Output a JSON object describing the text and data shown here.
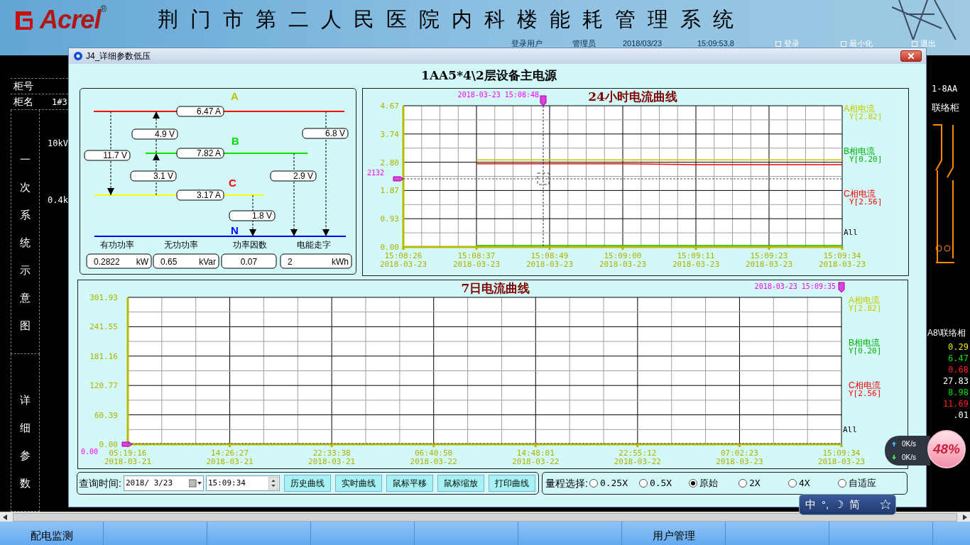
{
  "header": {
    "logo": "Acrel",
    "logo_mark": "®",
    "title": "荆门市第二人民医院内科楼能耗管理系统",
    "info": [
      "登录用户",
      "管理员",
      "2018/03/23",
      "15:09:53.8"
    ],
    "buttons": [
      "登录",
      "最小化",
      "退出"
    ]
  },
  "left_panel": {
    "rows": [
      {
        "label": "柜号"
      },
      {
        "label": "柜名",
        "value": "1#3"
      }
    ],
    "sections": [
      {
        "label": "一次系统示意图"
      },
      {
        "label": "详细参数"
      }
    ],
    "voltages": [
      "10kV",
      "0.4k"
    ]
  },
  "right_panel": {
    "cabinet": "1-8AA",
    "name": "联络柜",
    "title": "A8\\联络相",
    "values": [
      {
        "value": "0.29",
        "color": "#e8e800"
      },
      {
        "value": "6.47",
        "color": "#00e000"
      },
      {
        "value": "0.68",
        "color": "#ff2020"
      },
      {
        "value": "27.83",
        "color": "#ffffff"
      },
      {
        "value": "8.98",
        "color": "#00e000"
      },
      {
        "value": "11.69",
        "color": "#ff2020"
      },
      {
        "value": ".01",
        "color": "#ffffff"
      }
    ]
  },
  "dialog": {
    "title": "J4_详细参数低压",
    "heading": "1AA5*4\\2层设备主电源",
    "phasor": {
      "lines": [
        {
          "color": "#ff0000",
          "current": "6.47 A"
        },
        {
          "color": "#00e000",
          "current": "7.82 A"
        },
        {
          "color": "#ffff00",
          "current": "3.17 A"
        },
        {
          "color": "#0000ff"
        }
      ],
      "labels": [
        {
          "name": "A",
          "color": "#c0c000"
        },
        {
          "name": "B",
          "color": "#00e000"
        },
        {
          "name": "C",
          "color": "#ff0000"
        },
        {
          "name": "N",
          "color": "#0000ff"
        }
      ],
      "voltages": [
        "4.9 V",
        "6.8 V",
        "11.7 V",
        "3.1 V",
        "2.9 V",
        "1.8 V"
      ],
      "metrics": [
        {
          "label": "有功功率",
          "value": "0.2822",
          "unit": "kW"
        },
        {
          "label": "无功功率",
          "value": "0.65",
          "unit": "kVar"
        },
        {
          "label": "功率因数",
          "value": "0.07"
        },
        {
          "label": "电能走字",
          "value": "2",
          "unit": "kWh"
        }
      ]
    },
    "chart_24h": {
      "chart_data": {
        "type": "line",
        "title": "24小时电流曲线",
        "grid": true,
        "ylim": [
          0,
          4.67
        ],
        "categories": [
          "15:08:26",
          "15:08:37",
          "15:08:49",
          "15:09:00",
          "15:09:11",
          "15:09:23",
          "15:09:34"
        ],
        "yticks": [
          {
            "value": 0,
            "label": "0.00"
          },
          {
            "value": 0.93,
            "label": "0.93"
          },
          {
            "value": 1.87,
            "label": "1.87"
          },
          {
            "value": 2.8,
            "label": "2.80"
          },
          {
            "value": 3.74,
            "label": "3.74"
          },
          {
            "value": 4.67,
            "label": "4.67"
          }
        ],
        "series": [
          {
            "name": "A相电流",
            "color": "#c8c800",
            "values": [
              null,
              2.88,
              2.88,
              2.88,
              2.88,
              2.88,
              2.88
            ]
          },
          {
            "name": "B相电流",
            "color": "#00b000",
            "values": [
              null,
              0.05,
              0.05,
              0.05,
              0.05,
              0.05,
              0.05
            ]
          },
          {
            "name": "C相电流",
            "color": "#ff0000",
            "values": [
              null,
              2.75,
              2.75,
              2.75,
              2.72,
              2.72,
              2.72
            ]
          }
        ]
      },
      "dates": [
        "2018-03-23",
        "2018-03-23",
        "2018-03-23",
        "2018-03-23",
        "2018-03-23",
        "2018-03-23",
        "2018-03-23"
      ],
      "readings": [
        "Y[2.82]",
        "Y[0.20]",
        "Y[2.56]"
      ],
      "legend_all": "All",
      "cursor_time": "2018-03-23 15:08:48",
      "cursor_value": "2132"
    },
    "chart_7d": {
      "chart_data": {
        "type": "line",
        "title": "7日电流曲线",
        "grid": true,
        "ylim": [
          0,
          301.93
        ],
        "categories": [
          "05:19:16",
          "14:26:27",
          "22:33:38",
          "06:40:50",
          "14:48:01",
          "22:55:12",
          "07:02:23",
          "15:09:34"
        ],
        "yticks": [
          {
            "value": 0,
            "label": "0.00"
          },
          {
            "value": 60.39,
            "label": "60.39"
          },
          {
            "value": 120.77,
            "label": "120.77"
          },
          {
            "value": 181.16,
            "label": "181.16"
          },
          {
            "value": 241.55,
            "label": "241.55"
          },
          {
            "value": 301.93,
            "label": "301.93"
          }
        ],
        "series": [
          {
            "name": "A相电流",
            "color": "#c8c800",
            "values": [
              null,
              null,
              null,
              null,
              null,
              null,
              null,
              null
            ]
          },
          {
            "name": "B相电流",
            "color": "#00b000",
            "values": [
              null,
              null,
              null,
              null,
              null,
              null,
              null,
              null
            ]
          },
          {
            "name": "C相电流",
            "color": "#ff0000",
            "values": [
              null,
              null,
              null,
              null,
              null,
              null,
              null,
              null
            ]
          }
        ]
      },
      "dates": [
        "2018-03-21",
        "2018-03-21",
        "2018-03-21",
        "2018-03-22",
        "2018-03-22",
        "2018-03-22",
        "2018-03-23",
        "2018-03-23"
      ],
      "readings": [
        "Y[2.82]",
        "Y[0.20]",
        "Y[2.56]"
      ],
      "legend_all": "All",
      "cursor_time": "2018-03-23 15:09:35",
      "cursor_value": "0.00"
    },
    "controls": {
      "query_label": "查询时间:",
      "date": "2018/ 3/23",
      "time": "15:09:34",
      "buttons": [
        "历史曲线",
        "实时曲线",
        "鼠标平移",
        "鼠标缩放",
        "打印曲线"
      ],
      "range_label": "量程选择:",
      "range_options": [
        {
          "label": "0.25X",
          "selected": false
        },
        {
          "label": "0.5X",
          "selected": false
        },
        {
          "label": "原始",
          "selected": true
        },
        {
          "label": "2X",
          "selected": false
        },
        {
          "label": "4X",
          "selected": false
        },
        {
          "label": "自适应",
          "selected": false
        }
      ]
    }
  },
  "bottom_nav": [
    "配电监测",
    "用户管理"
  ],
  "net_widget": {
    "upload": "0K/s",
    "download": "0K/s",
    "percent": "48%"
  },
  "ime": [
    "中",
    "°,",
    "☽",
    "简"
  ]
}
